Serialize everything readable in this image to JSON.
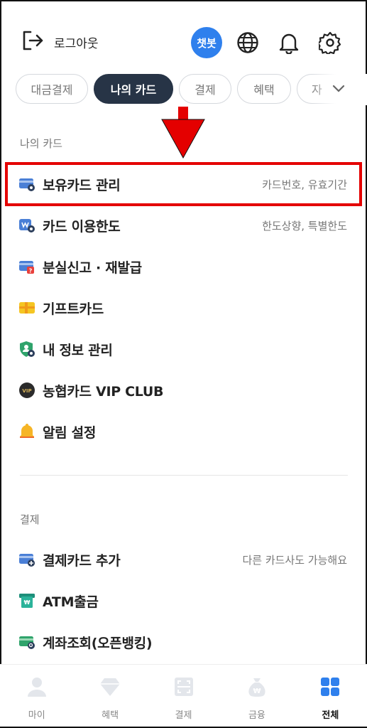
{
  "header": {
    "logout_label": "로그아웃",
    "chatbot_label": "챗봇"
  },
  "tabs": [
    {
      "label": "대금결제"
    },
    {
      "label": "나의 카드",
      "active": true
    },
    {
      "label": "결제"
    },
    {
      "label": "혜택"
    },
    {
      "label": "자"
    }
  ],
  "sections": {
    "my_card": {
      "title": "나의 카드",
      "items": [
        {
          "label": "보유카드 관리",
          "sub": "카드번호, 유효기간",
          "icon": "card-settings-icon"
        },
        {
          "label": "카드 이용한도",
          "sub": "한도상향, 특별한도",
          "icon": "card-limit-icon"
        },
        {
          "label": "분실신고 · 재발급",
          "sub": "",
          "icon": "card-lost-icon"
        },
        {
          "label": "기프트카드",
          "sub": "",
          "icon": "gift-card-icon"
        },
        {
          "label": "내 정보 관리",
          "sub": "",
          "icon": "user-settings-icon"
        },
        {
          "label": "농협카드 VIP CLUB",
          "sub": "",
          "icon": "vip-icon"
        },
        {
          "label": "알림 설정",
          "sub": "",
          "icon": "bell-icon"
        }
      ]
    },
    "payment": {
      "title": "결제",
      "items": [
        {
          "label": "결제카드 추가",
          "sub": "다른 카드사도 가능해요",
          "icon": "card-add-icon"
        },
        {
          "label": "ATM출금",
          "sub": "",
          "icon": "atm-icon"
        },
        {
          "label": "계좌조회(오픈뱅킹)",
          "sub": "",
          "icon": "account-lookup-icon"
        }
      ]
    }
  },
  "bottom_nav": [
    {
      "label": "마이",
      "icon": "person-icon"
    },
    {
      "label": "혜택",
      "icon": "diamond-icon"
    },
    {
      "label": "결제",
      "icon": "scan-icon"
    },
    {
      "label": "금융",
      "icon": "money-bag-icon"
    },
    {
      "label": "전체",
      "icon": "grid-icon",
      "active": true
    }
  ],
  "colors": {
    "accent_blue": "#2f80ed",
    "active_tab": "#273446",
    "highlight_red": "#e40000"
  }
}
